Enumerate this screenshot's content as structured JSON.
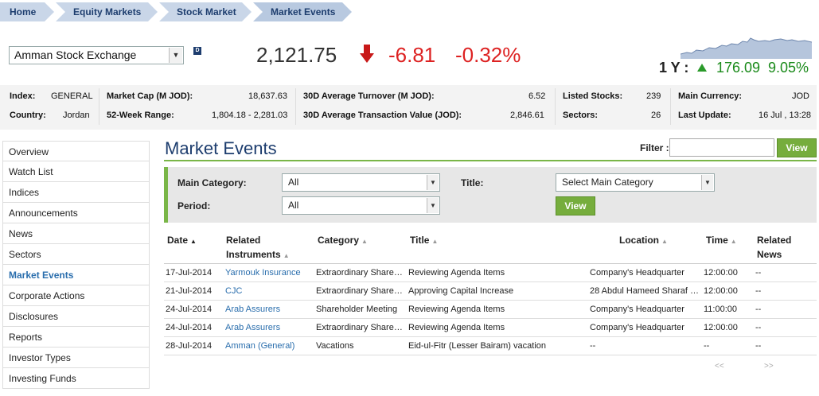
{
  "breadcrumb": [
    "Home",
    "Equity Markets",
    "Stock Market",
    "Market Events"
  ],
  "exchange": {
    "selected": "Amman Stock Exchange",
    "badge": "D"
  },
  "index": {
    "value": "2,121.75",
    "change": "-6.81",
    "change_pct": "-0.32%"
  },
  "year": {
    "label": "1 Y :",
    "change": "176.09",
    "change_pct": "9.05%"
  },
  "colors": {
    "accent_green": "#7ab648",
    "navy": "#1d3d6e",
    "link": "#2a6ead",
    "down": "#dd2222",
    "up": "#1a8a1a"
  },
  "info": {
    "index_label": "Index:",
    "index_value": "GENERAL",
    "country_label": "Country:",
    "country_value": "Jordan",
    "mcap_label": "Market Cap (M JOD):",
    "mcap_value": "18,637.63",
    "range_label": "52-Week Range:",
    "range_value": "1,804.18 - 2,281.03",
    "turnover_label": "30D Average Turnover (M JOD):",
    "turnover_value": "6.52",
    "txval_label": "30D Average Transaction Value (JOD):",
    "txval_value": "2,846.61",
    "listed_label": "Listed Stocks:",
    "listed_value": "239",
    "sectors_label": "Sectors:",
    "sectors_value": "26",
    "currency_label": "Main Currency:",
    "currency_value": "JOD",
    "update_label": "Last Update:",
    "update_value": "16 Jul , 13:28"
  },
  "sidebar": {
    "items": [
      "Overview",
      "Watch List",
      "Indices",
      "Announcements",
      "News",
      "Sectors",
      "Market Events",
      "Corporate Actions",
      "Disclosures",
      "Reports",
      "Investor Types",
      "Investing Funds"
    ],
    "active": "Market Events"
  },
  "page": {
    "title": "Market Events",
    "filter_label": "Filter :",
    "filter_value": "",
    "view_label": "View"
  },
  "filters": {
    "main_category_label": "Main Category:",
    "main_category_value": "All",
    "period_label": "Period:",
    "period_value": "All",
    "title_label": "Title:",
    "title_value": "Select Main Category",
    "view_label": "View"
  },
  "table": {
    "headers": {
      "date": "Date",
      "related": "Related",
      "instruments": "Instruments",
      "category": "Category",
      "title": "Title",
      "location": "Location",
      "time": "Time",
      "related_news_1": "Related",
      "related_news_2": "News"
    },
    "rows": [
      {
        "date": "17-Jul-2014",
        "instrument": "Yarmouk Insurance",
        "category": "Extraordinary Share…",
        "title": "Reviewing Agenda Items",
        "location": "Company's Headquarter",
        "time": "12:00:00",
        "news": "--"
      },
      {
        "date": "21-Jul-2014",
        "instrument": "CJC",
        "category": "Extraordinary Share…",
        "title": "Approving Capital Increase",
        "location": "28 Abdul Hameed Sharaf …",
        "time": "12:00:00",
        "news": "--"
      },
      {
        "date": "24-Jul-2014",
        "instrument": "Arab Assurers",
        "category": "Shareholder Meeting",
        "title": "Reviewing Agenda Items",
        "location": "Company's Headquarter",
        "time": "11:00:00",
        "news": "--"
      },
      {
        "date": "24-Jul-2014",
        "instrument": "Arab Assurers",
        "category": "Extraordinary Share…",
        "title": "Reviewing Agenda Items",
        "location": "Company's Headquarter",
        "time": "12:00:00",
        "news": "--"
      },
      {
        "date": "28-Jul-2014",
        "instrument": "Amman (General)",
        "category": "Vacations",
        "title": "Eid-ul-Fitr (Lesser Bairam) vacation",
        "location": "--",
        "time": "--",
        "news": "--"
      }
    ]
  },
  "pager": {
    "prev": "<<",
    "next": ">>"
  }
}
